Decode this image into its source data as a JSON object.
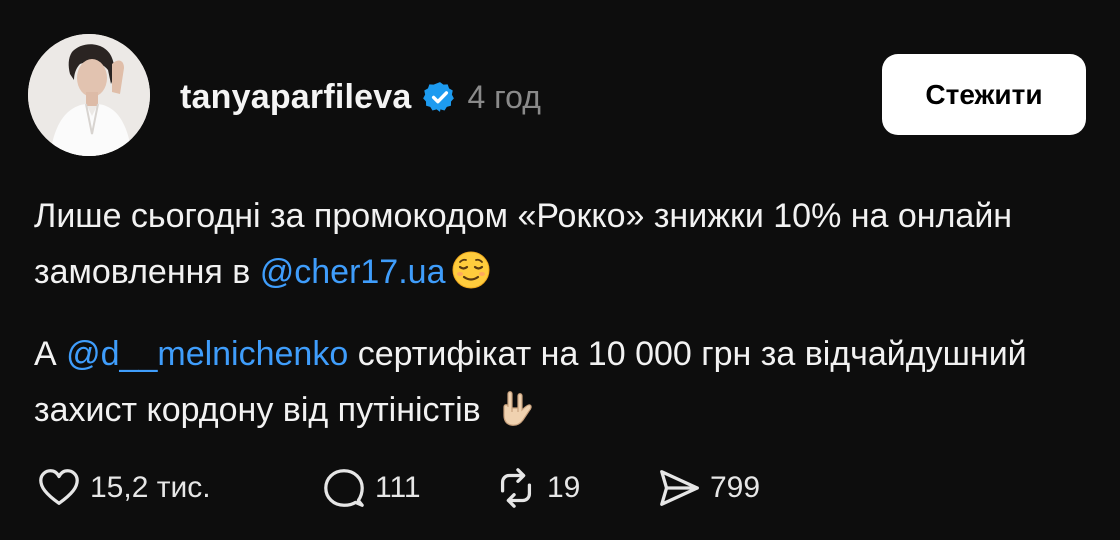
{
  "post": {
    "author": {
      "username": "tanyaparfileva",
      "verified": true,
      "time_ago": "4 год",
      "avatar_icon": "avatar-photo"
    },
    "follow_label": "Стежити",
    "paragraph1": {
      "text1": "Лише сьогодні за промокодом «Рокко» знижки 10% на онлайн замовлення в ",
      "mention": "@cher17.ua",
      "emoji": "relieved-face-emoji"
    },
    "paragraph2": {
      "text_before": "А ",
      "mention": "@d__melnichenko",
      "text_after": " сертифікат на 10 000 грн за відчайдушний захист кордону від путіністів ",
      "emoji": "sign-of-the-horns-emoji"
    },
    "actions": {
      "likes": "15,2 тис.",
      "comments": "111",
      "reposts": "19",
      "shares": "799"
    }
  },
  "colors": {
    "background": "#0d0d0d",
    "mention": "#3f9dfb",
    "verified_badge": "#1d9bf0",
    "muted_text": "#8a8a8a",
    "follow_button_bg": "#ffffff"
  }
}
